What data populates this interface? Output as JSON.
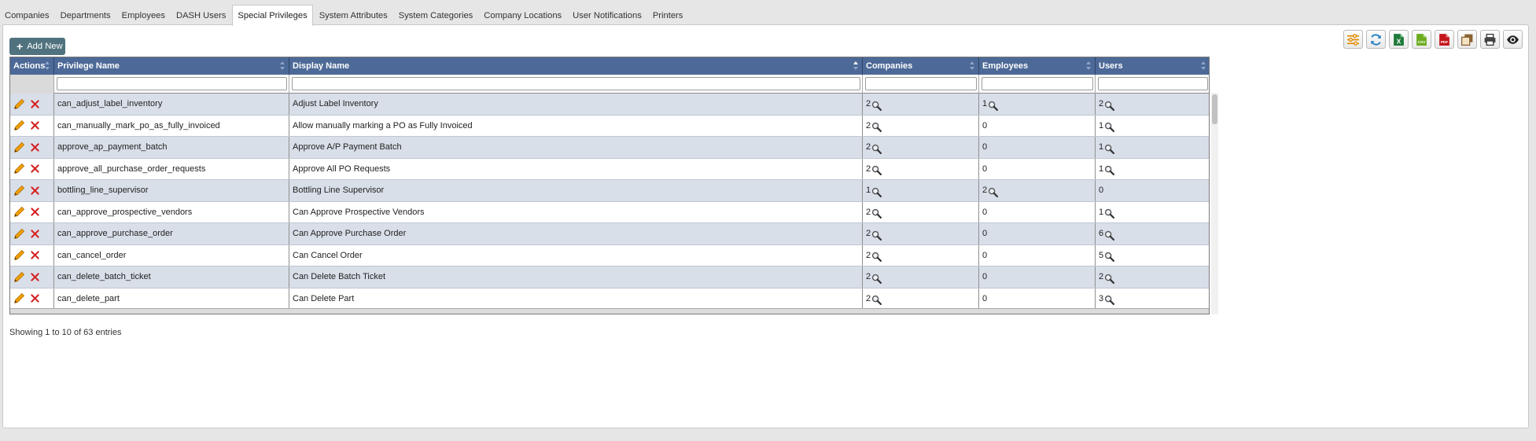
{
  "tabs": [
    {
      "label": "Companies",
      "active": false
    },
    {
      "label": "Departments",
      "active": false
    },
    {
      "label": "Employees",
      "active": false
    },
    {
      "label": "DASH Users",
      "active": false
    },
    {
      "label": "Special Privileges",
      "active": true
    },
    {
      "label": "System Attributes",
      "active": false
    },
    {
      "label": "System Categories",
      "active": false
    },
    {
      "label": "Company Locations",
      "active": false
    },
    {
      "label": "User Notifications",
      "active": false
    },
    {
      "label": "Printers",
      "active": false
    }
  ],
  "actions": {
    "add_new_label": "Add New"
  },
  "toolbar": [
    "settings-icon",
    "refresh-icon",
    "excel-icon",
    "csv-icon",
    "pdf-icon",
    "copy-icon",
    "print-icon",
    "eye-icon"
  ],
  "colors": {
    "header_bg": "#4c6997",
    "row_alt_bg": "#d9dfe9",
    "add_button_bg": "#50727e",
    "edit_icon": "#f0a000",
    "delete_icon": "#d62020"
  },
  "grid": {
    "columns": [
      {
        "key": "actions",
        "label": "Actions",
        "sort": "none"
      },
      {
        "key": "privilege_name",
        "label": "Privilege Name",
        "sort": "none"
      },
      {
        "key": "display_name",
        "label": "Display Name",
        "sort": "asc"
      },
      {
        "key": "companies",
        "label": "Companies",
        "sort": "none"
      },
      {
        "key": "employees",
        "label": "Employees",
        "sort": "none"
      },
      {
        "key": "users",
        "label": "Users",
        "sort": "none"
      }
    ],
    "rows": [
      {
        "privilege_name": "can_adjust_label_inventory",
        "display_name": "Adjust Label Inventory",
        "companies": "2",
        "companies_search": true,
        "employees": "1",
        "employees_search": true,
        "users": "2",
        "users_search": true
      },
      {
        "privilege_name": "can_manually_mark_po_as_fully_invoiced",
        "display_name": "Allow manually marking a PO as Fully Invoiced",
        "companies": "2",
        "companies_search": true,
        "employees": "0",
        "employees_search": false,
        "users": "1",
        "users_search": true
      },
      {
        "privilege_name": "approve_ap_payment_batch",
        "display_name": "Approve A/P Payment Batch",
        "companies": "2",
        "companies_search": true,
        "employees": "0",
        "employees_search": false,
        "users": "1",
        "users_search": true
      },
      {
        "privilege_name": "approve_all_purchase_order_requests",
        "display_name": "Approve All PO Requests",
        "companies": "2",
        "companies_search": true,
        "employees": "0",
        "employees_search": false,
        "users": "1",
        "users_search": true
      },
      {
        "privilege_name": "bottling_line_supervisor",
        "display_name": "Bottling Line Supervisor",
        "companies": "1",
        "companies_search": true,
        "employees": "2",
        "employees_search": true,
        "users": "0",
        "users_search": false
      },
      {
        "privilege_name": "can_approve_prospective_vendors",
        "display_name": "Can Approve Prospective Vendors",
        "companies": "2",
        "companies_search": true,
        "employees": "0",
        "employees_search": false,
        "users": "1",
        "users_search": true
      },
      {
        "privilege_name": "can_approve_purchase_order",
        "display_name": "Can Approve Purchase Order",
        "companies": "2",
        "companies_search": true,
        "employees": "0",
        "employees_search": false,
        "users": "6",
        "users_search": true
      },
      {
        "privilege_name": "can_cancel_order",
        "display_name": "Can Cancel Order",
        "companies": "2",
        "companies_search": true,
        "employees": "0",
        "employees_search": false,
        "users": "5",
        "users_search": true
      },
      {
        "privilege_name": "can_delete_batch_ticket",
        "display_name": "Can Delete Batch Ticket",
        "companies": "2",
        "companies_search": true,
        "employees": "0",
        "employees_search": false,
        "users": "2",
        "users_search": true
      },
      {
        "privilege_name": "can_delete_part",
        "display_name": "Can Delete Part",
        "companies": "2",
        "companies_search": true,
        "employees": "0",
        "employees_search": false,
        "users": "3",
        "users_search": true
      }
    ]
  },
  "footer": {
    "status": "Showing 1 to 10 of 63 entries"
  }
}
